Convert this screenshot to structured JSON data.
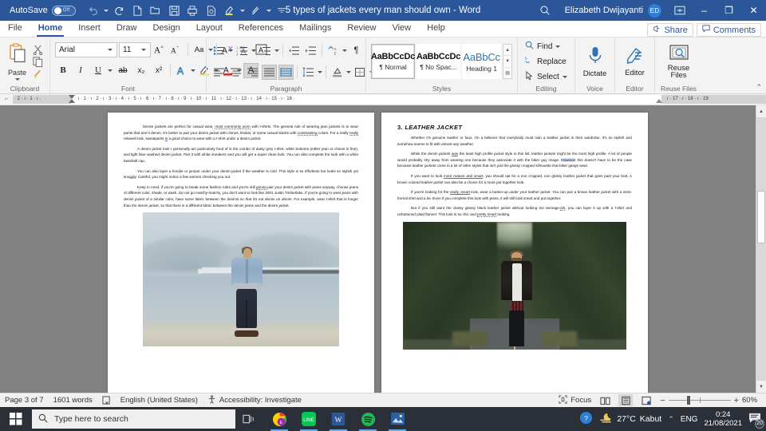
{
  "titlebar": {
    "autosave_label": "AutoSave",
    "autosave_state": "Off",
    "document_title": "5 types of jackets every man should own  -  Word",
    "user_name": "Elizabeth Dwijayanti",
    "user_initials": "ED",
    "quick_access": [
      {
        "name": "undo-icon",
        "label": "Undo"
      },
      {
        "name": "redo-icon",
        "label": "Redo"
      },
      {
        "name": "new-document-icon",
        "label": "New"
      },
      {
        "name": "open-folder-icon",
        "label": "Open"
      },
      {
        "name": "save-icon",
        "label": "Save"
      },
      {
        "name": "print-icon",
        "label": "Quick Print"
      },
      {
        "name": "print-preview-icon",
        "label": "Print Preview"
      },
      {
        "name": "highlight-icon",
        "label": "Text Highlight Color"
      },
      {
        "name": "format-painter-icon",
        "label": "Format Painter"
      },
      {
        "name": "customize-qat-icon",
        "label": "Customize Quick Access Toolbar"
      }
    ],
    "window_buttons": {
      "minimize": "–",
      "restore": "❐",
      "close": "✕"
    }
  },
  "tabs": [
    {
      "label": "File",
      "active": false
    },
    {
      "label": "Home",
      "active": true
    },
    {
      "label": "Insert",
      "active": false
    },
    {
      "label": "Draw",
      "active": false
    },
    {
      "label": "Design",
      "active": false
    },
    {
      "label": "Layout",
      "active": false
    },
    {
      "label": "References",
      "active": false
    },
    {
      "label": "Mailings",
      "active": false
    },
    {
      "label": "Review",
      "active": false
    },
    {
      "label": "View",
      "active": false
    },
    {
      "label": "Help",
      "active": false
    }
  ],
  "tabbar_right": {
    "share_label": "Share",
    "comments_label": "Comments"
  },
  "ribbon": {
    "clipboard": {
      "group_label": "Clipboard",
      "paste_label": "Paste",
      "cut_label": "Cut",
      "copy_label": "Copy",
      "format_painter_label": "Format Painter"
    },
    "font": {
      "group_label": "Font",
      "font_family": "Arial",
      "font_size": "11",
      "buttons": [
        {
          "name": "grow-font",
          "glyph": "A"
        },
        {
          "name": "shrink-font",
          "glyph": "A"
        },
        {
          "name": "change-case",
          "glyph": "Aa"
        },
        {
          "name": "clear-formatting",
          "glyph": "A"
        },
        {
          "name": "phonetic-guide",
          "glyph": "A"
        },
        {
          "name": "character-border",
          "glyph": "A"
        }
      ],
      "bold": "B",
      "italic": "I",
      "underline": "U",
      "strikethrough": "ab",
      "subscript": "x₂",
      "superscript": "x²",
      "text_effects": "A",
      "highlight": "A",
      "font_color": "A",
      "shading": "A",
      "character_shading": "A"
    },
    "paragraph": {
      "group_label": "Paragraph",
      "buttons": [
        "bullets",
        "numbering",
        "multilevel-list",
        "decrease-indent",
        "increase-indent",
        "sort",
        "show-formatting-marks",
        "align-left",
        "align-center",
        "align-right",
        "justify",
        "line-spacing",
        "paragraph-spacing",
        "shading",
        "borders"
      ]
    },
    "styles": {
      "group_label": "Styles",
      "gallery": [
        {
          "sample": "AaBbCcDc",
          "name": "¶ Normal",
          "selected": true
        },
        {
          "sample": "AaBbCcDc",
          "name": "¶ No Spac...",
          "selected": false
        },
        {
          "sample": "AaBbCc",
          "name": "Heading 1",
          "selected": false
        }
      ]
    },
    "editing": {
      "group_label": "Editing",
      "find_label": "Find",
      "replace_label": "Replace",
      "select_label": "Select"
    },
    "voice": {
      "group_label": "Voice",
      "dictate_label": "Dictate"
    },
    "editor": {
      "group_label": "Editor",
      "editor_label": "Editor"
    },
    "reuse": {
      "group_label": "Reuse Files",
      "reuse_label": "Reuse\nFiles",
      "line1": "Reuse",
      "line2": "Files"
    }
  },
  "ruler": {
    "marks": "· 2 · ı · 1 · ı ·",
    "marks_main": "· ı · 1 · ı · 2 · ı · 3 · ı · 4 · ı · 5 · ı · 6 · ı · 7 · ı · 8 · ı · 9 · ı · 10 · ı · 11 · ı · 12 · ı · 13 · ı · 14 · ı · 15 · ı · 16 ·",
    "marks_tail": "ı · 17 · ı · 18 · ı · 19"
  },
  "document": {
    "left_page": {
      "paragraphs": [
        "Denim jackets are perfect for casual wear, most commonly worn with t-shirts. The general rule of wearing jean jackets is to wear pants that aren't denim. It's better to pair your denim jacket with chinos, khakis, or some casual slacks with constrasting colors. For a really really relaxed look, sweatpants is a good choice to wear with a t-shirt under a denim jacket.",
        "A denim jacket look I personally am particularly fond of is the combo of dusty grey t-shirt, white bottoms (either jean or chinos is fine), and light blue washed denim jacket. Pair it with white sneakers and you will get a super clean look. You can also complete the look with a white baseball cap.",
        "You can also layer a hoodie or jumper under your denim jacket if the weather is cold. This style is so effortless but looks so stylish yet snuggly. Careful, you might notice a few women checking you out.",
        "Keep in mind, if you're going to break some fashion rules and you're still gonna pair your denim jacket with jeans anyway, choose jeans of different color, shade, or wash. Do not go matchy-matchy, you don't want to look like 2001 Justin Timberlake. If you're going to wear jeans with denim jacket of a similar color, have some fabric between the denims so that it's not denim on denim. For example, wear t-shirt that is longer than the denim jacket, so that there is a different fabric between the denim jeans and the denim jacket."
      ],
      "image_alt": "Man in light blue denim jacket standing by a misty lake"
    },
    "right_page": {
      "heading_number": "3.",
      "heading_text": "LEATHER JACKET",
      "paragraphs": [
        "Whether it's genuine leather or faux, I'm a believer that everybody must own a leather jacket in their wardrobe. It's so stylish and somehow seems to fit with almost any weather.",
        "While the denim jackets was the least high profile jacket style in this list, leather jackets might be the most high profile. A lot of people would probably shy away from wearing one because they associate it with the biker guy image. However this doesn't have to be the case because leather jackets come in a lot of other styles that isn't just the glossy cropped silhouette that biker gangs wear.",
        "If you want to look more mature and smart, you should opt for a non cropped, non glossy leather jacket that goes past your butt. A brown colored leather jacket can also be a choice for a more put together look.",
        "If you're looking for the really, smart look, wear a button-up under your leather jacket. You can pair a brown leather jacket with a semi-formal shirt and a tie. Even if you complete this look with jeans, it will still look smart and put together.",
        "But if you still want the classy glossy black leather jacket without looking too teenage-ish, you can layer it up with a t-shirt and unbuttoned plaid flannel. This look is so chic and pretty smart looking."
      ],
      "image_alt": "Man in black leather jacket standing on a forest road"
    }
  },
  "statusbar": {
    "page_info": "Page 3 of 7",
    "word_count": "1601 words",
    "language": "English (United States)",
    "accessibility": "Accessibility: Investigate",
    "focus_label": "Focus",
    "zoom_level": "60%",
    "view_buttons": [
      "read-mode",
      "print-layout",
      "web-layout"
    ]
  },
  "taskbar": {
    "search_placeholder": "Type here to search",
    "apps": [
      {
        "name": "chrome-icon",
        "label": "Google Chrome"
      },
      {
        "name": "line-icon",
        "label": "LINE"
      },
      {
        "name": "word-icon",
        "label": "Microsoft Word"
      },
      {
        "name": "spotify-icon",
        "label": "Spotify"
      },
      {
        "name": "photos-icon",
        "label": "Photos"
      }
    ],
    "help_icon": "help-icon",
    "weather_temp": "27°C",
    "weather_desc": "Kabut",
    "language": "ENG",
    "time": "0:24",
    "date": "21/08/2021",
    "notification_count": "20"
  },
  "colors": {
    "word_blue": "#2b579a",
    "accent_tab": "#2b579a",
    "doc_background": "#818181",
    "taskbar": "#2a2f38",
    "heading_blue": "#2e74b5"
  }
}
